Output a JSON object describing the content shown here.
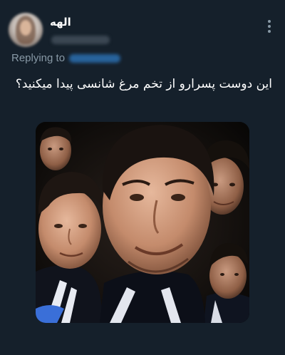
{
  "tweet": {
    "display_name": "الهه",
    "replying_to_label": "Replying to",
    "text": "این دوست پسرارو از تخم مرغ شانسی پیدا میکنید؟"
  },
  "colors": {
    "background": "#15202b",
    "secondary_text": "#8899a6",
    "link": "#1d9bf0"
  },
  "icons": {
    "more": "more-options-icon"
  },
  "media": {
    "description_type": "photo-collage"
  }
}
